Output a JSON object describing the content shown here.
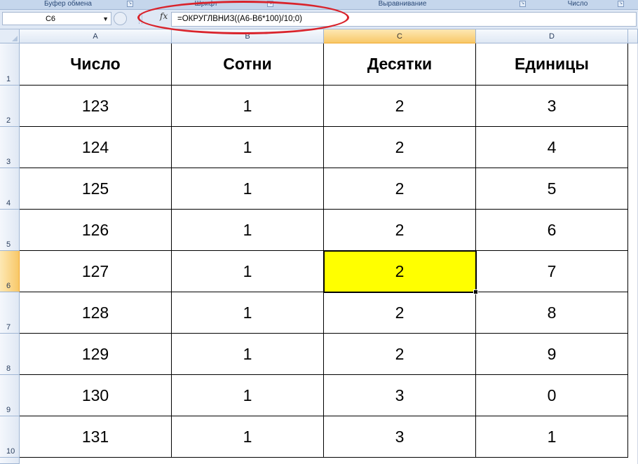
{
  "ribbon": {
    "groups": [
      {
        "label": "Буфер обмена"
      },
      {
        "label": "Шрифт"
      },
      {
        "label": "Выравнивание"
      },
      {
        "label": "Число"
      }
    ],
    "dialog_launcher_glyph": "↘"
  },
  "formula_bar": {
    "name_box": "C6",
    "fx_label": "fx",
    "formula": "=ОКРУГЛВНИЗ((A6-B6*100)/10;0)"
  },
  "highlight": {
    "color": "#d9232b"
  },
  "columns": [
    "A",
    "B",
    "C",
    "D"
  ],
  "rows": [
    "1",
    "2",
    "3",
    "4",
    "5",
    "6",
    "7",
    "8",
    "9",
    "10"
  ],
  "selected": {
    "column": "C",
    "row": "6",
    "fill_color": "#ffff00"
  },
  "table": {
    "headers": [
      "Число",
      "Сотни",
      "Десятки",
      "Единицы"
    ],
    "data": [
      [
        "123",
        "1",
        "2",
        "3"
      ],
      [
        "124",
        "1",
        "2",
        "4"
      ],
      [
        "125",
        "1",
        "2",
        "5"
      ],
      [
        "126",
        "1",
        "2",
        "6"
      ],
      [
        "127",
        "1",
        "2",
        "7"
      ],
      [
        "128",
        "1",
        "2",
        "8"
      ],
      [
        "129",
        "1",
        "2",
        "9"
      ],
      [
        "130",
        "1",
        "3",
        "0"
      ],
      [
        "131",
        "1",
        "3",
        "1"
      ]
    ]
  }
}
